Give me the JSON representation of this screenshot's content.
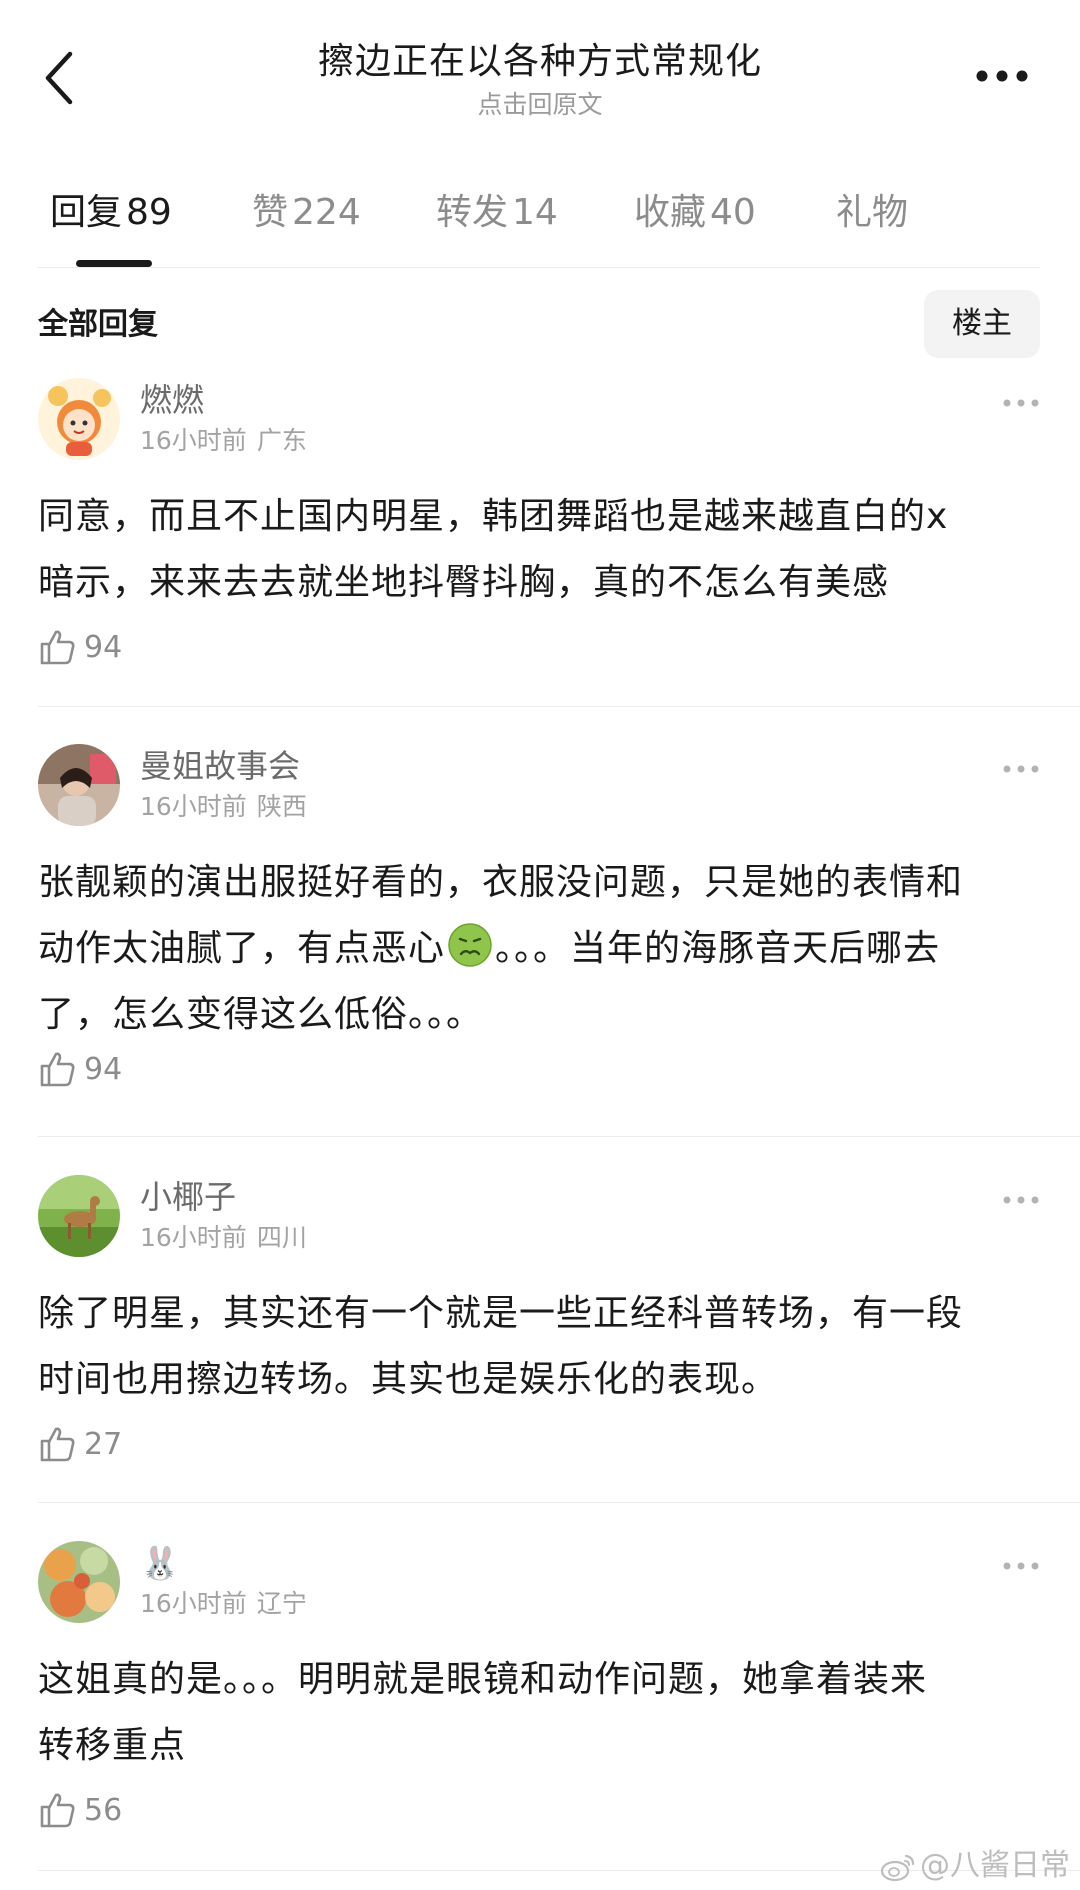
{
  "header": {
    "title": "擦边正在以各种方式常规化",
    "subtitle": "点击回原文",
    "back_icon": "chevron-left-icon",
    "more_icon": "more-horizontal-icon"
  },
  "tabs": [
    {
      "label": "回复",
      "count": "89",
      "active": true
    },
    {
      "label": "赞",
      "count": "224"
    },
    {
      "label": "转发",
      "count": "14"
    },
    {
      "label": "收藏",
      "count": "40"
    },
    {
      "label": "礼物",
      "count": ""
    }
  ],
  "section": {
    "title": "全部回复",
    "filter_label": "楼主"
  },
  "comments": [
    {
      "username": "燃燃",
      "time": "16小时前",
      "location": "广东",
      "content_lines": [
        "同意，而且不止国内明星，韩团舞蹈也是越来越直白的x",
        "暗示，来来去去就坐地抖臀抖胸，真的不怎么有美感"
      ],
      "likes": "94"
    },
    {
      "username": "曼姐故事会",
      "time": "16小时前",
      "location": "陕西",
      "content_lines": [
        "张靓颖的演出服挺好看的，衣服没问题，只是她的表情和",
        "动作太油腻了，有点恶心",
        "。。。当年的海豚音天后哪去",
        "了，怎么变得这么低俗。。。"
      ],
      "emoji": "nauseated-face-emoji",
      "likes": "94"
    },
    {
      "username": "小椰子",
      "time": "16小时前",
      "location": "四川",
      "content_lines": [
        "除了明星，其实还有一个就是一些正经科普转场，有一段",
        "时间也用擦边转场。其实也是娱乐化的表现。"
      ],
      "likes": "27"
    },
    {
      "username": "🐰",
      "time": "16小时前",
      "location": "辽宁",
      "content_lines": [
        "这姐真的是。。。明明就是眼镜和动作问题，她拿着装来",
        "转移重点"
      ],
      "likes": "56"
    }
  ],
  "watermark": "@八酱日常",
  "colors": {
    "text_primary": "#1a1a1a",
    "text_secondary": "#8c8c8c",
    "divider": "#ececec",
    "filter_bg": "#f3f3f3"
  }
}
